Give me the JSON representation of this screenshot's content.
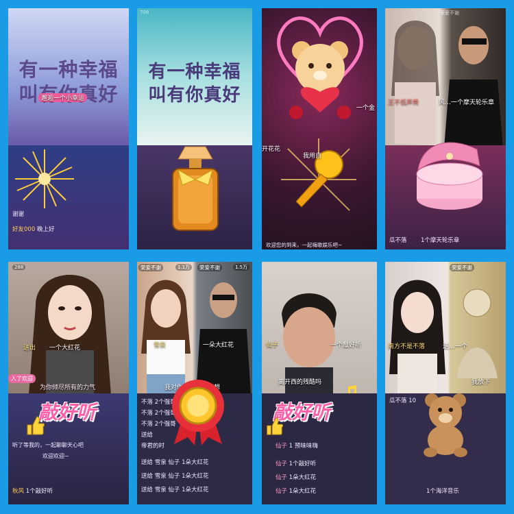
{
  "colors": {
    "background": "#1a9be6",
    "chat_nick": "#ffcf5c",
    "danmu_red": "#ff6b6b"
  },
  "tiles": {
    "t1": {
      "poster_line1": "有一种幸福",
      "poster_line2": "叫有你真好",
      "danmu1": "邂逅一个小幸运",
      "chat1": "谢谢",
      "chat2_nick": "好友000",
      "chat2_text": "晚上好",
      "gift_icon": "firework-icon"
    },
    "t2": {
      "statusbar": "708",
      "poster_line1": "有一种幸福",
      "poster_line2": "叫有你真好",
      "gift_icon": "perfume-bottle-icon"
    },
    "t3": {
      "danmu1": "开花花",
      "danmu2": "我用自",
      "danmu3": "一个金",
      "chat1": "欢迎您的到来，一起嗨歌娱乐吧~",
      "gift_icon": "bear-heart-icon",
      "gift_icon2": "golden-microphone-icon"
    },
    "t4": {
      "statusbar": "荣爱不谢",
      "danmu1": "王不低声秀",
      "danmu2": "风…一个摩天轮乐章",
      "chat1": "瓜不落",
      "chat2": "1个摩天轮乐章",
      "gift_icon": "music-box-icon"
    },
    "t5": {
      "viewers": "288",
      "danmu1": "送出",
      "danmu2": "一个大红花",
      "join": "入了欢迎",
      "danmu3": "为你倾尽所有的力气",
      "chat1_nick": "秋风",
      "chat1_text": "1个敲好听",
      "chat2": "听了等我的，一起聊聊天心吧",
      "chat3": "欢迎欢迎~",
      "fx_title": "敲好听"
    },
    "t6": {
      "count1": "1.1万",
      "count2": "1.5万",
      "host1": "荣爱不谢",
      "host2": "荣爱不谢",
      "danmu1": "雪泉",
      "danmu2": "一朵大红花",
      "danmu3": "我对你大想念太想想",
      "chat_lines": [
        "不落 2个强哥",
        "不落 2个强哥",
        "不落 2个强哥",
        "送给",
        "帝君的时",
        "送给  雪泉  仙子   1朵大红花",
        "送给  雪泉  仙子   1朵大红花",
        "送给  雪泉  仙子   1朵大红花"
      ],
      "gift_icon": "gold-medal-rosette-icon"
    },
    "t7": {
      "danmu1": "仙子",
      "danmu2": "一个敲好听",
      "danmu3": "离开西的残酷吗",
      "fx_title": "敲好听",
      "chat1_nick": "仙子",
      "chat1_text": "1 预味味嗨",
      "chat2_nick": "仙子",
      "chat2_text": "1个敲好听",
      "chat3_nick": "仙子",
      "chat3_text": "1朵大红花",
      "chat4_nick": "仙子",
      "chat4_text": "1朵大红花"
    },
    "t8": {
      "count": "荣爱不谢",
      "danmu1": "南方不是不落",
      "danmu2": "送…一个",
      "danmu3": "我放下",
      "chat1": "瓜不落 10",
      "chat2": "1个海洋音乐",
      "gift_icon": "teddy-bear-icon"
    }
  }
}
